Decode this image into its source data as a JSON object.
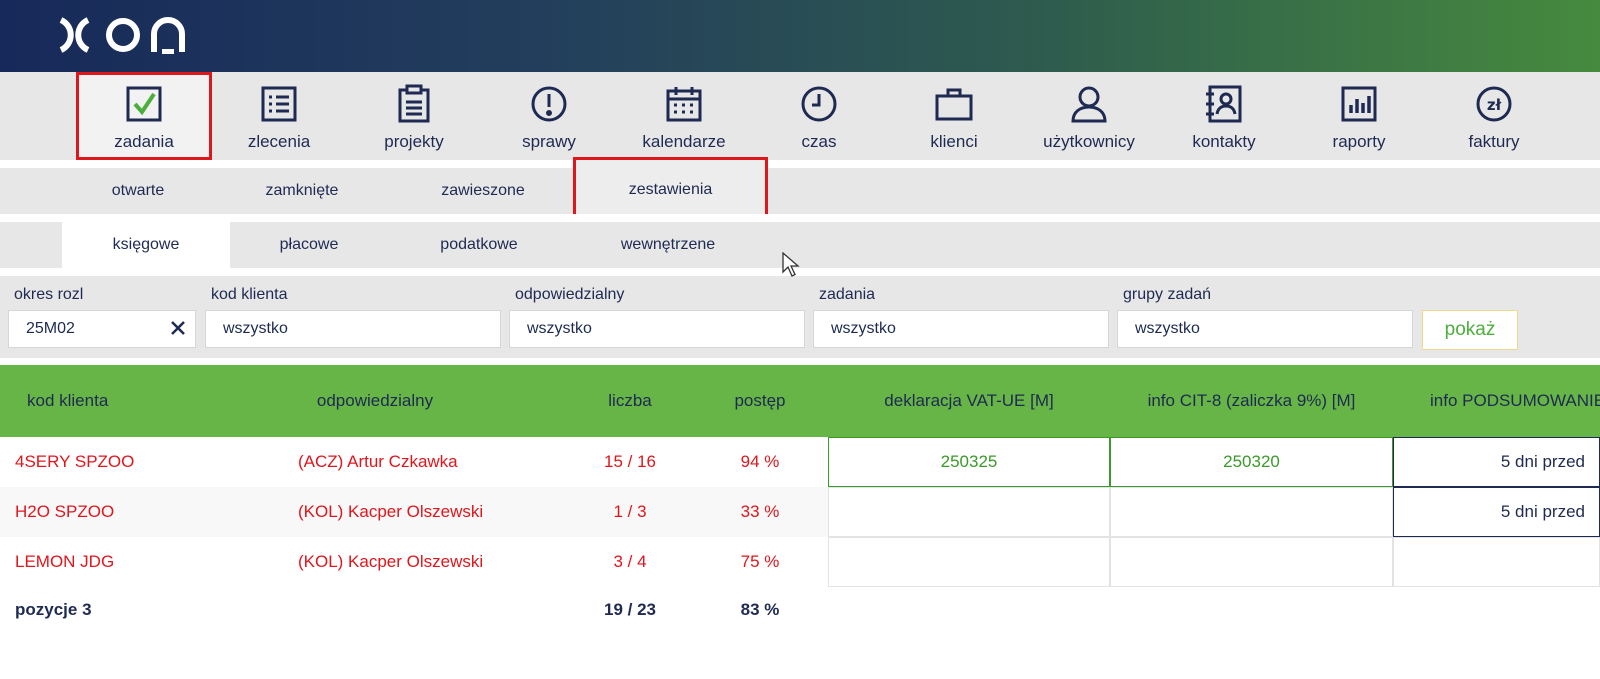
{
  "brand": {
    "logo_text": "XON"
  },
  "main_nav": [
    {
      "label": "zadania",
      "icon": "checkbox-icon",
      "active": true
    },
    {
      "label": "zlecenia",
      "icon": "list-icon"
    },
    {
      "label": "projekty",
      "icon": "clipboard-icon"
    },
    {
      "label": "sprawy",
      "icon": "exclamation-icon"
    },
    {
      "label": "kalendarze",
      "icon": "calendar-icon"
    },
    {
      "label": "czas",
      "icon": "clock-icon"
    },
    {
      "label": "klienci",
      "icon": "briefcase-icon"
    },
    {
      "label": "użytkownicy",
      "icon": "user-icon"
    },
    {
      "label": "kontakty",
      "icon": "address-book-icon"
    },
    {
      "label": "raporty",
      "icon": "bar-chart-icon"
    },
    {
      "label": "faktury",
      "icon": "currency-icon"
    }
  ],
  "sub_nav": [
    "otwarte",
    "zamknięte",
    "zawieszone",
    "zestawienia"
  ],
  "sub_nav2": [
    "księgowe",
    "płacowe",
    "podatkowe",
    "wewnętrzene"
  ],
  "filters": {
    "period": {
      "label": "okres rozl",
      "value": "25M02"
    },
    "client": {
      "label": "kod klienta",
      "value": "wszystko"
    },
    "responsible": {
      "label": "odpowiedzialny",
      "value": "wszystko"
    },
    "tasks": {
      "label": "zadania",
      "value": "wszystko"
    },
    "groups": {
      "label": "grupy zadań",
      "value": "wszystko"
    },
    "show_button": "pokaż"
  },
  "table": {
    "headers": [
      "kod klienta",
      "odpowiedzialny",
      "liczba",
      "postęp",
      "deklaracja VAT-UE [M]",
      "info CIT-8 (zaliczka 9%) [M]",
      "info PODSUMOWANIE"
    ],
    "rows": [
      {
        "client": "4SERY SPZOO",
        "responsible": "(ACZ) Artur Czkawka",
        "count": "15 / 16",
        "progress": "94 %",
        "vat_ue": "250325",
        "cit8": "250320",
        "summary": "5 dni przed"
      },
      {
        "client": "H2O SPZOO",
        "responsible": "(KOL) Kacper Olszewski",
        "count": "1 / 3",
        "progress": "33 %",
        "vat_ue": "",
        "cit8": "",
        "summary": "5 dni przed"
      },
      {
        "client": "LEMON JDG",
        "responsible": "(KOL) Kacper Olszewski",
        "count": "3 / 4",
        "progress": "75 %",
        "vat_ue": "",
        "cit8": "",
        "summary": ""
      }
    ],
    "footer": {
      "label": "pozycje 3",
      "count": "19 / 23",
      "progress": "83 %"
    }
  },
  "colors": {
    "accent_green": "#67b546",
    "navy": "#1e2a52",
    "alert_red": "#e0161d"
  }
}
